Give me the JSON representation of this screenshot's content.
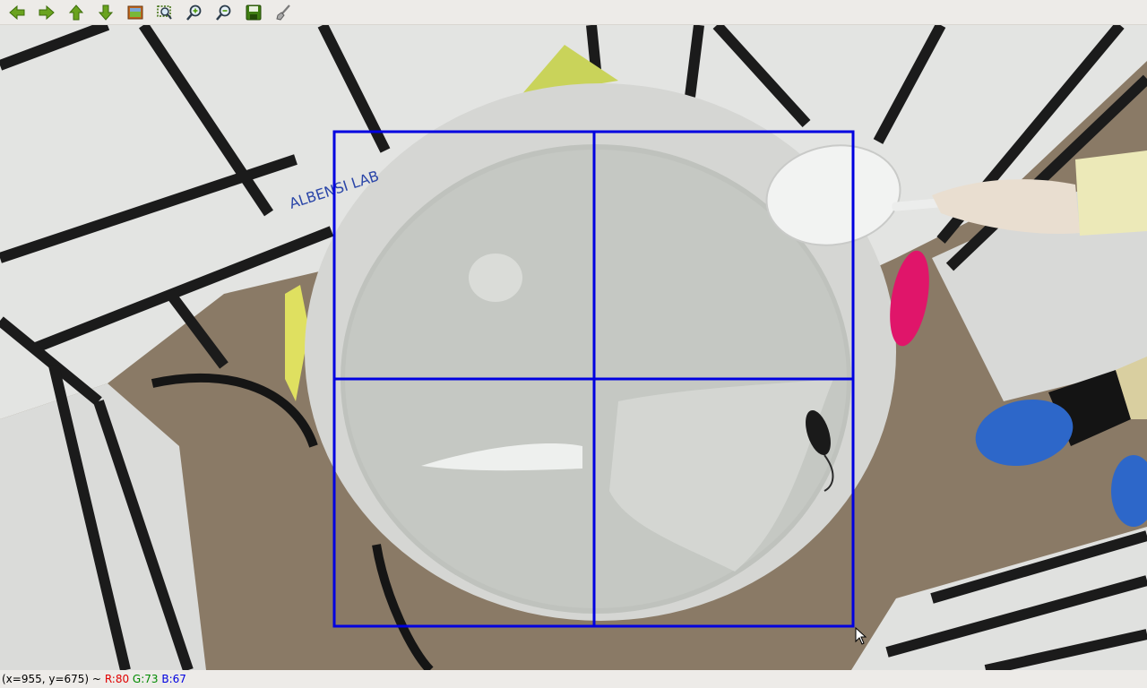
{
  "toolbar": {
    "buttons": [
      {
        "name": "pan-left-button",
        "icon": "arrow-left-icon"
      },
      {
        "name": "pan-right-button",
        "icon": "arrow-right-icon"
      },
      {
        "name": "pan-up-button",
        "icon": "arrow-up-icon"
      },
      {
        "name": "pan-down-button",
        "icon": "arrow-down-icon"
      },
      {
        "name": "zoom-fit-button",
        "icon": "picture-icon"
      },
      {
        "name": "zoom-region-button",
        "icon": "zoom-region-icon"
      },
      {
        "name": "zoom-in-button",
        "icon": "zoom-in-icon"
      },
      {
        "name": "zoom-out-button",
        "icon": "zoom-out-icon"
      },
      {
        "name": "save-button",
        "icon": "save-icon"
      },
      {
        "name": "properties-button",
        "icon": "brush-icon"
      }
    ],
    "icon_color": "#4e9a06"
  },
  "image": {
    "overlay_color": "#0000e0",
    "grid": "2x2 quadrants",
    "wall_label": "ALBENSI LAB"
  },
  "status": {
    "coords": "(x=955, y=675) ~ ",
    "r": "R:80",
    "g": "G:73",
    "b": "B:67"
  }
}
